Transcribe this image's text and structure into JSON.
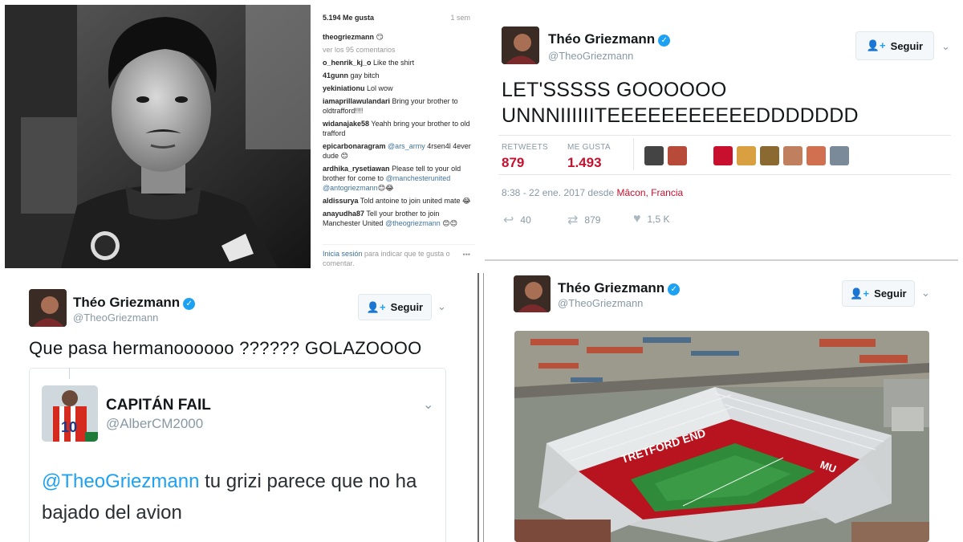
{
  "instagram": {
    "likes": "5.194 Me gusta",
    "time": "1 sem",
    "caption_user": "theogriezmann",
    "caption_emoji": "😏",
    "view_comments": "ver los 95 comentarios",
    "comments": [
      {
        "user": "o_henrik_kj_o",
        "text": "Like the shirt"
      },
      {
        "user": "41gunn",
        "text": "gay bitch"
      },
      {
        "user": "yekiniationu",
        "text": "Lol wow"
      },
      {
        "user": "iamaprillawulandari",
        "text": "Bring your brother to oldtrafford!!!!"
      },
      {
        "user": "widanajake58",
        "text": "Yeahh bring your brother to old trafford"
      },
      {
        "user": "epicarbonaragram",
        "mention": "@ars_army",
        "text": "4rsen4l 4ever dude 😊"
      },
      {
        "user": "ardhika_rysetiawan",
        "text": "Please tell to your old brother for come to",
        "mention": "@manchesterunited",
        "mention2": "@antogriezmann",
        "text2": "😊😂"
      },
      {
        "user": "aldissurya",
        "text": "Told antoine to join united mate 😂"
      },
      {
        "user": "anayudha87",
        "text": "Tell your brother to join Manchester United",
        "mention": "@theogriezmann",
        "text2": "😊😊"
      }
    ],
    "login_link": "Inicia sesión",
    "login_text": "para indicar que te gusta o comentar.",
    "more": "•••"
  },
  "tweet1": {
    "name": "Théo Griezmann",
    "handle": "@TheoGriezmann",
    "follow_label": "Seguir",
    "text_line1": "LET'SSSSS GOOOOOO",
    "text_line2": "UNNNIIIIIITEEEEEEEEEEEDDDDDDD",
    "retweets_label": "RETWEETS",
    "retweets": "879",
    "likes_label": "ME GUSTA",
    "likes": "1.493",
    "date": "8:38 - 22 ene. 2017 desde",
    "location": "Mâcon, Francia",
    "reply_count": "40",
    "retweet_count": "879",
    "like_count": "1,5 K"
  },
  "tweet2": {
    "name": "Théo Griezmann",
    "handle": "@TheoGriezmann",
    "follow_label": "Seguir",
    "text": "Que pasa hermanoooooo ?????? GOLAZOOOO",
    "quote_name": "CAPITÁN FAIL",
    "quote_handle": "@AlberCM2000",
    "quote_mention": "@TheoGriezmann",
    "quote_text": " tu grizi parece que no ha bajado del avion",
    "quote_jersey_number": "10"
  },
  "tweet3": {
    "name": "Théo Griezmann",
    "handle": "@TheoGriezmann",
    "follow_label": "Seguir",
    "stadium_sign": "TRETFORD END",
    "stadium_sign_right": "MU"
  },
  "icons": {
    "verified": "verified-badge-icon",
    "follow": "add-user-icon",
    "chevron": "chevron-down-icon",
    "reply": "reply-icon",
    "retweet": "retweet-icon",
    "like": "heart-icon"
  },
  "colors": {
    "twitter_blue": "#1da1f2",
    "stat_red": "#c8102e",
    "muted": "#8899a6",
    "united_red": "#c8102e"
  }
}
